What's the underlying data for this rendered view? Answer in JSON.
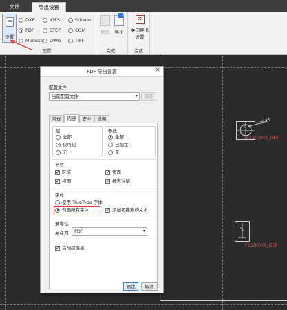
{
  "ribbon": {
    "tabs": [
      {
        "label": "文件"
      },
      {
        "label": "导出设置"
      }
    ],
    "setup_button": {
      "label": "设置"
    },
    "formats": [
      {
        "label": "DXF",
        "selected": false
      },
      {
        "label": "IGES",
        "selected": false
      },
      {
        "label": "Stheno",
        "selected": false
      },
      {
        "label": "PDF",
        "selected": true
      },
      {
        "label": "STEP",
        "selected": false
      },
      {
        "label": "CGM",
        "selected": false
      },
      {
        "label": "Medusa",
        "selected": false
      },
      {
        "label": "DWG",
        "selected": false
      },
      {
        "label": "TIFF",
        "selected": false
      }
    ],
    "groups": {
      "config": "配置",
      "finish": "完成",
      "finish2": "完成"
    },
    "preview_label": "预览",
    "export_label": "导出",
    "close_label_line1": "关闭导出",
    "close_label_line2": "设置"
  },
  "workspace": {
    "csys_label_1": "F13(CSYS_DEF",
    "csys_label_2": "F13(CSYS_DEF",
    "dim_label": "ø6.44",
    "marker_z": "Z"
  },
  "dialog": {
    "title": "PDF 导出设置",
    "config_file_label": "配置文件",
    "config_file_value": "当前配置文件",
    "save_button": "保存",
    "tabs": [
      "常规",
      "内容",
      "安全",
      "说明"
    ],
    "active_tab": "内容",
    "layers": {
      "title": "层",
      "options": [
        {
          "label": "全部",
          "selected": false
        },
        {
          "label": "仅可见",
          "selected": true
        },
        {
          "label": "无",
          "selected": false
        }
      ]
    },
    "params": {
      "title": "参数",
      "options": [
        {
          "label": "全部",
          "selected": true
        },
        {
          "label": "已指定",
          "selected": false
        },
        {
          "label": "无",
          "selected": false
        }
      ]
    },
    "bookmarks": {
      "title": "书签",
      "items": [
        {
          "label": "区域",
          "checked": true
        },
        {
          "label": "页面",
          "checked": true
        },
        {
          "label": "视图",
          "checked": true
        },
        {
          "label": "标志注解",
          "checked": true
        }
      ]
    },
    "fonts": {
      "title": "字体",
      "use_truetype": "使用 TrueType 字体",
      "stroke_all": "勾画所有字体",
      "add_searchable": "添加可搜索的文本",
      "use_truetype_selected": false,
      "stroke_all_selected": true,
      "add_searchable_checked": true
    },
    "compat": {
      "title": "兼容性",
      "save_as_label": "另存为",
      "save_as_value": "PDF"
    },
    "hyperlinks": {
      "label": "活动超链接",
      "checked": true
    },
    "ok_button": "确定",
    "cancel_button": "取消"
  }
}
